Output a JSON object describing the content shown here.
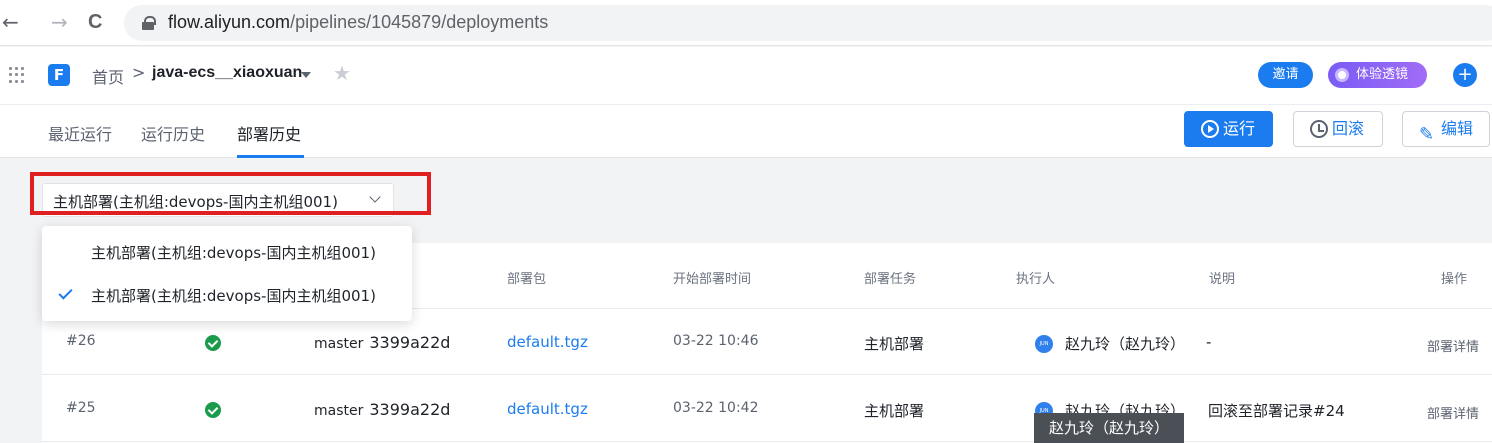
{
  "browser": {
    "back_glyph": "←",
    "forward_glyph": "→",
    "reload_glyph": "C",
    "url_host": "flow.aliyun.com",
    "url_path": "/pipelines/1045879/deployments"
  },
  "header": {
    "logo_text": "F",
    "home_label": "首页",
    "separator": ">",
    "project_name": "java-ecs__xiaoxuan",
    "star_glyph": "★",
    "invite_label": "邀请",
    "trial_label": "体验透镜",
    "plus_glyph": "+"
  },
  "tabs": [
    {
      "label": "最近运行",
      "active": false
    },
    {
      "label": "运行历史",
      "active": false
    },
    {
      "label": "部署历史",
      "active": true
    }
  ],
  "actions": {
    "run_label": "运行",
    "rollback_label": "回滚",
    "edit_label": "编辑",
    "pencil_glyph": "✎"
  },
  "env_select": {
    "selected": "主机部署(主机组:devops-国内主机组001)"
  },
  "dropdown": {
    "options": [
      {
        "label": "主机部署(主机组:devops-国内主机组001)",
        "checked": false
      },
      {
        "label": "主机部署(主机组:devops-国内主机组001)",
        "checked": true
      }
    ]
  },
  "table": {
    "headers": {
      "package": "部署包",
      "start_time": "开始部署时间",
      "task": "部署任务",
      "executor": "执行人",
      "note": "说明",
      "action": "操作"
    },
    "rows": [
      {
        "id": "#26",
        "status": "success",
        "branch": "master",
        "hash": "3399a22d",
        "package": "default.tgz",
        "start_time": "03-22 10:46",
        "task": "主机部署",
        "avatar_text": "JUN",
        "executor": "赵九玲（赵九玲）",
        "note": "-",
        "action": "部署详情"
      },
      {
        "id": "#25",
        "status": "success",
        "branch": "master",
        "hash": "3399a22d",
        "package": "default.tgz",
        "start_time": "03-22 10:42",
        "task": "主机部署",
        "avatar_text": "JUN",
        "executor": "赵九玲（赵九玲）",
        "note": "回滚至部署记录#24",
        "action": "部署详情"
      }
    ]
  },
  "tooltip": {
    "text": "赵九玲（赵九玲）"
  },
  "colors": {
    "accent": "#1b7cf0",
    "success": "#1a9b4b",
    "highlight_border": "#e02020",
    "trial_purple": "#7a5cf5"
  }
}
